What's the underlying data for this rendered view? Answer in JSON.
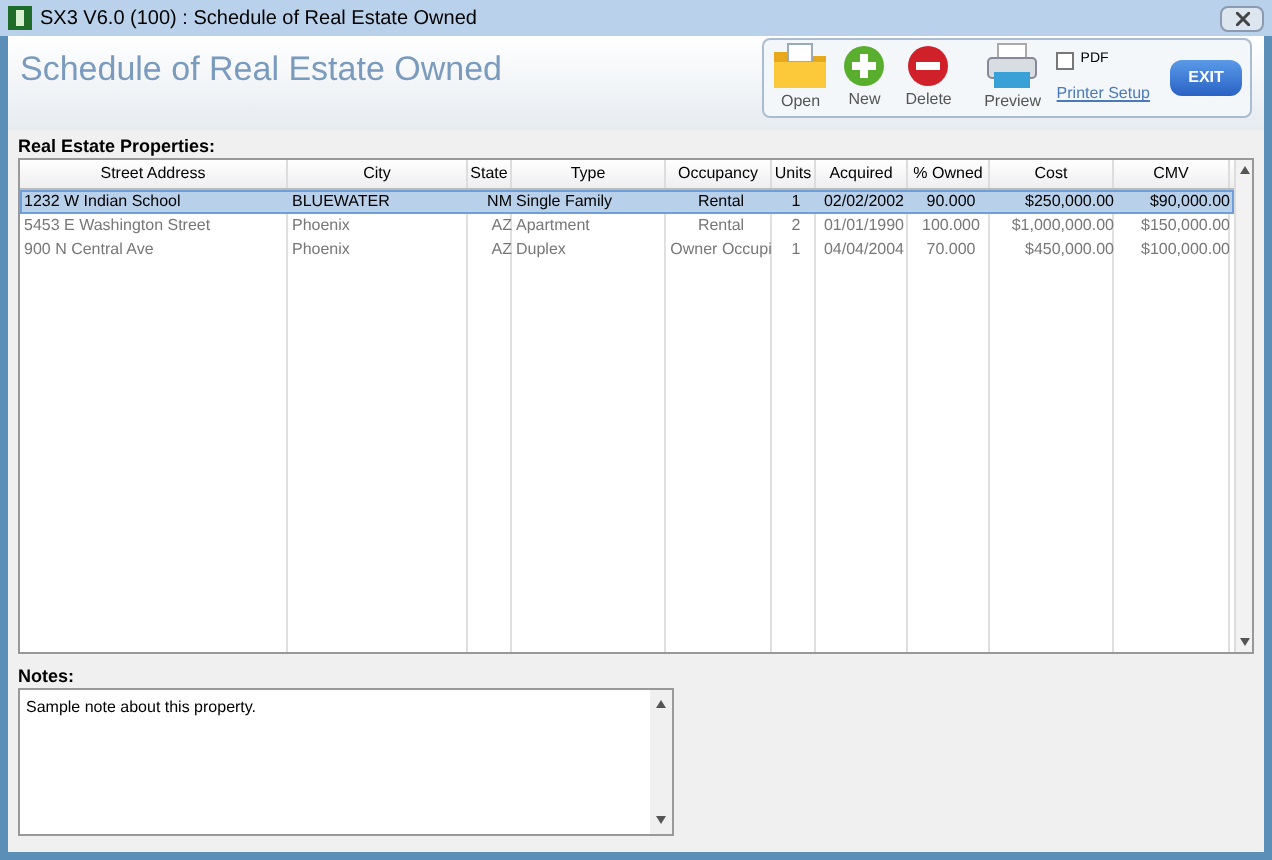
{
  "window": {
    "title": "SX3 V6.0 (100) : Schedule of Real Estate Owned"
  },
  "header": {
    "title": "Schedule of Real Estate Owned"
  },
  "toolbar": {
    "buttons": [
      {
        "kind": "open",
        "label": "Open"
      },
      {
        "kind": "new",
        "label": "New"
      },
      {
        "kind": "delete",
        "label": "Delete"
      },
      {
        "kind": "preview",
        "label": "Preview"
      }
    ],
    "pdf": {
      "label": "PDF",
      "checked": false
    },
    "printer_setup": "Printer Setup",
    "exit": "EXIT"
  },
  "properties": {
    "label": "Real Estate Properties:",
    "columns": [
      "Street Address",
      "City",
      "State",
      "Type",
      "Occupancy",
      "Units",
      "Acquired",
      "% Owned",
      "Cost",
      "CMV"
    ],
    "rows": [
      {
        "selected": true,
        "cells": [
          "1232 W Indian School",
          "BLUEWATER",
          "NM",
          "Single Family",
          "Rental",
          "1",
          "02/02/2002",
          "90.000",
          "$250,000.00",
          "$90,000.00"
        ]
      },
      {
        "selected": false,
        "cells": [
          "5453 E Washington Street",
          "Phoenix",
          "AZ",
          "Apartment",
          "Rental",
          "2",
          "01/01/1990",
          "100.000",
          "$1,000,000.00",
          "$150,000.00"
        ]
      },
      {
        "selected": false,
        "cells": [
          "900 N Central Ave",
          "Phoenix",
          "AZ",
          "Duplex",
          "Owner Occupi",
          "1",
          "04/04/2004",
          "70.000",
          "$450,000.00",
          "$100,000.00"
        ]
      }
    ]
  },
  "notes": {
    "label": "Notes:",
    "value": "Sample note about this property."
  }
}
